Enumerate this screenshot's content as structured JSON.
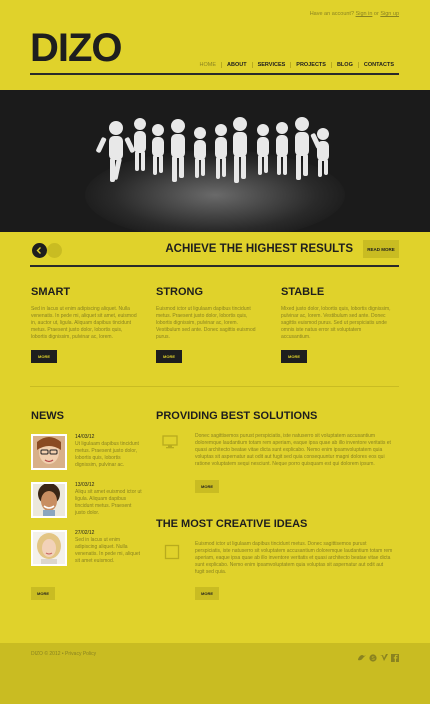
{
  "header": {
    "account_prefix": "Have an account?",
    "sign_in": "Sign in",
    "or": "or",
    "sign_up": "Sign up",
    "logo": "DIZO",
    "nav": [
      "HOME",
      "ABOUT",
      "SERVICES",
      "PROJECTS",
      "BLOG",
      "CONTACTS"
    ]
  },
  "slider": {
    "tagline": "ACHIEVE THE HIGHEST RESULTS",
    "read_more": "READ MORE"
  },
  "features": [
    {
      "title": "SMART",
      "text": "Sed in lacus ut enim adipiscing aliquet. Nulla venenatis. In pede mi, aliquet sit amet, euismod in, auctor ut, ligula. Aliquam dapibus tincidunt metus. Praesent justo dolor, lobortis quis, lobortis dignissim, pulvinar ac, lorem.",
      "button": "MORE"
    },
    {
      "title": "STRONG",
      "text": "Euismod ictor ut ligulaam dapibus tincidunt metus. Praesent justo dolor, lobortis quis, lobortis dignissim, pulvinar ac, lorem. Vestibulum sed ante. Donec sagittis euismod purus.",
      "button": "MORE"
    },
    {
      "title": "STABLE",
      "text": "Mixed justo dolor, lobortis quis, lobortis dignissim, pulvinar ac, lorem. Vestibulum sed ante. Donec sagittis euismod purus. Sed ut perspiciatis unde omnis iste natus error sit voluptatem accusantium.",
      "button": "MORE"
    }
  ],
  "news": {
    "title": "NEWS",
    "items": [
      {
        "date": "14/03/12",
        "text": "Ut ligulaam dapibus tincidunt metus. Praesent justo dolor, lobortis quis, lobortis dignissim, pulvinar ac."
      },
      {
        "date": "13/03/12",
        "text": "Aliqu sit amet euismod ictor ut ligula. Aliquam dapibus tincidunt metus. Praesent justo dolor."
      },
      {
        "date": "27/02/12",
        "text": "Sed in lacus ut enim adipiscing aliquet. Nulla venenatis. In pede mi, aliquet sit amet euismod."
      }
    ],
    "button": "MORE"
  },
  "solutions": {
    "title": "PROVIDING BEST SOLUTIONS",
    "text": "Donec sagittisemos purust perspiciatis, iste natuserro sit voluptatem accusantium doloremque laudantium totam rem aperiam, eaque ipsa quae ab illo inventore veritatis et quasi architecto beatae vitae dicta sunt explicabo. Nemo enim ipsamvoluptatem quia voluptas sit aspernatur aut odit aut fugit sed quia consequuntur magni dolores eos qui ratione voluptatem sequi nesciunt. Neque porro quisquam est qui dolorem ipsum.",
    "button": "MORE"
  },
  "creative": {
    "title": "THE MOST CREATIVE IDEAS",
    "text": "Euismod ictor ut ligulaam dapibus tincidunt metus. Donec sagittisemos purust perspiciatis, iste natuserro sit voluptatem accusantium doloremque laudantium totam rem aperiam, eaque ipsa quae ab illo inventore veritatis et quasi architecto beatae vitae dicta sunt explicabo. Nemo enim ipsamvoluptatem quia voluptas sit aspernatur aut odit aut fugit sed quia.",
    "button": "MORE"
  },
  "footer": {
    "copyright": "DIZO © 2012 • Privacy Policy",
    "social_icons": [
      "twitter-icon",
      "skype-icon",
      "vimeo-icon",
      "facebook-icon"
    ]
  },
  "colors": {
    "accent": "#e0d22b",
    "dark": "#1e1e1e",
    "olive": "#c9bc22"
  }
}
